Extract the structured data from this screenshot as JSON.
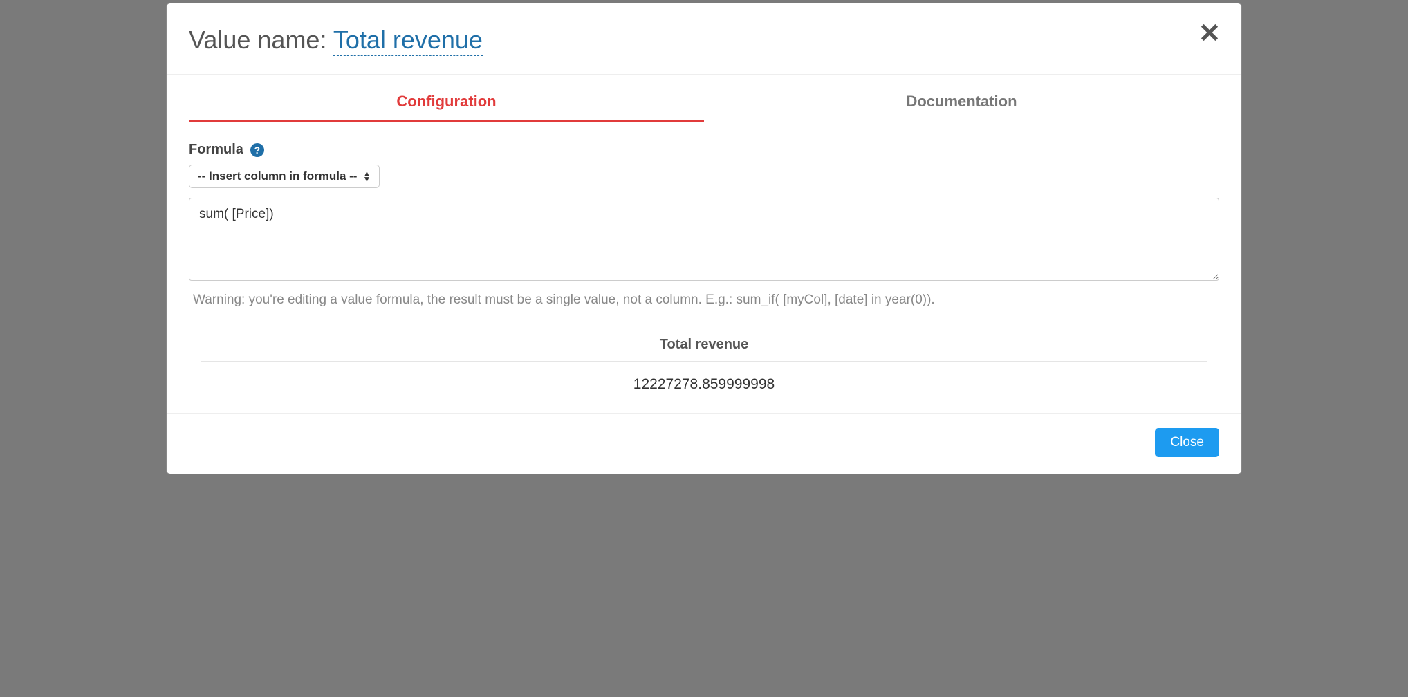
{
  "header": {
    "title_label": "Value name: ",
    "title_value": "Total revenue"
  },
  "tabs": {
    "configuration": "Configuration",
    "documentation": "Documentation"
  },
  "formula": {
    "label": "Formula",
    "dropdown_label": "-- Insert column in formula --",
    "textarea_value": "sum( [Price])",
    "warning": "Warning: you're editing a value formula, the result must be a single value, not a column. E.g.: sum_if( [myCol], [date] in year(0))."
  },
  "result": {
    "header": "Total revenue",
    "value": "12227278.859999998"
  },
  "footer": {
    "close_label": "Close"
  }
}
